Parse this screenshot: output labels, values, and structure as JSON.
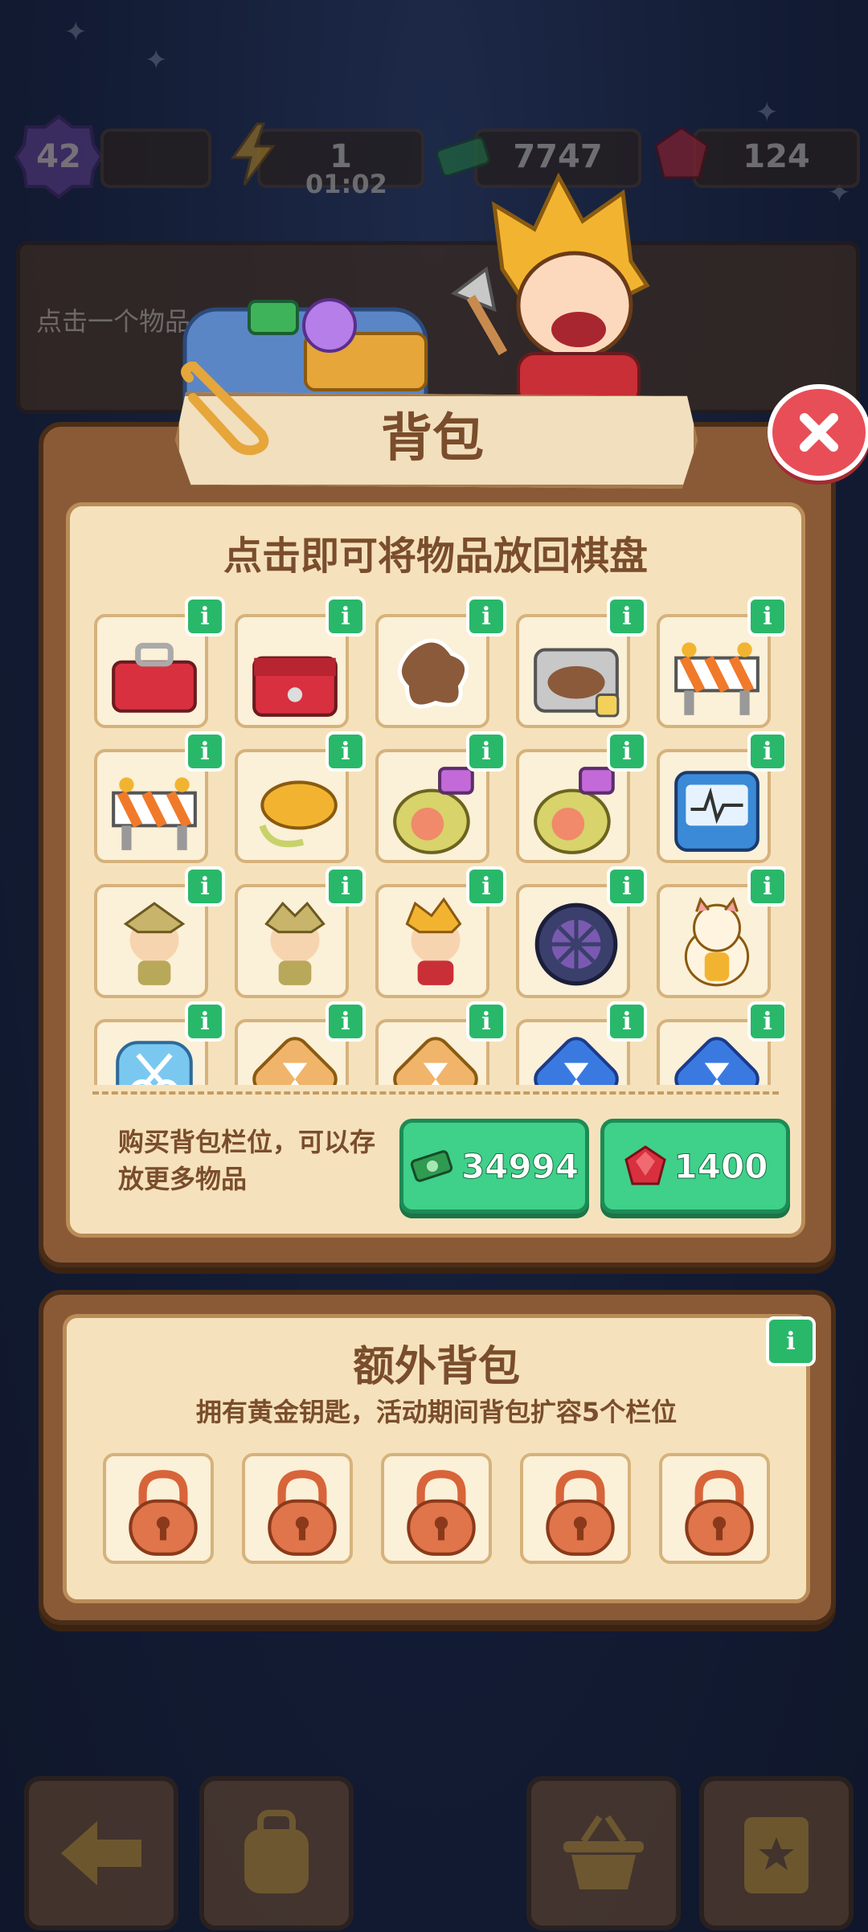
{
  "top_bar": {
    "level": "42",
    "energy": "1",
    "energy_timer": "01:02",
    "cash": "7747",
    "gems": "124"
  },
  "hint": {
    "text": "点击一个物品"
  },
  "backpack": {
    "title": "背包",
    "subtitle": "点击即可将物品放回棋盘",
    "items": [
      {
        "icon": "red-toolbox-icon"
      },
      {
        "icon": "red-tool-chest-icon"
      },
      {
        "icon": "dirt-stain-icon"
      },
      {
        "icon": "dirty-sink-icon"
      },
      {
        "icon": "road-barrier-icon"
      },
      {
        "icon": "road-barrier-icon"
      },
      {
        "icon": "coiled-rope-icon"
      },
      {
        "icon": "spray-bag-icon"
      },
      {
        "icon": "spray-bag-icon"
      },
      {
        "icon": "heart-monitor-icon"
      },
      {
        "icon": "sprout-kid-icon"
      },
      {
        "icon": "sprout-girl-icon"
      },
      {
        "icon": "crown-girl-icon"
      },
      {
        "icon": "wheel-icon"
      },
      {
        "icon": "lucky-cat-icon"
      },
      {
        "icon": "blue-scissors-icon"
      },
      {
        "icon": "orange-hourglass-icon"
      },
      {
        "icon": "orange-hourglass-icon"
      },
      {
        "icon": "blue-hourglass-icon"
      },
      {
        "icon": "blue-hourglass-icon"
      }
    ],
    "buy_text": "购买背包栏位，可以存放更多物品",
    "buy_cash_value": "34994",
    "buy_gem_value": "1400",
    "colors": {
      "accent_green": "#3fd08a",
      "info_green": "#29b86a",
      "close_red": "#e84e57"
    }
  },
  "extra_backpack": {
    "title": "额外背包",
    "description": "拥有黄金钥匙，活动期间背包扩容5个栏位",
    "slots": [
      {
        "icon": "padlock-icon"
      },
      {
        "icon": "padlock-icon"
      },
      {
        "icon": "padlock-icon"
      },
      {
        "icon": "padlock-icon"
      },
      {
        "icon": "padlock-icon"
      }
    ]
  },
  "bottom_nav": [
    {
      "icon": "back-arrow-icon"
    },
    {
      "icon": "backpack-icon"
    },
    {
      "icon": "basket-icon"
    },
    {
      "icon": "clipboard-star-icon"
    }
  ]
}
